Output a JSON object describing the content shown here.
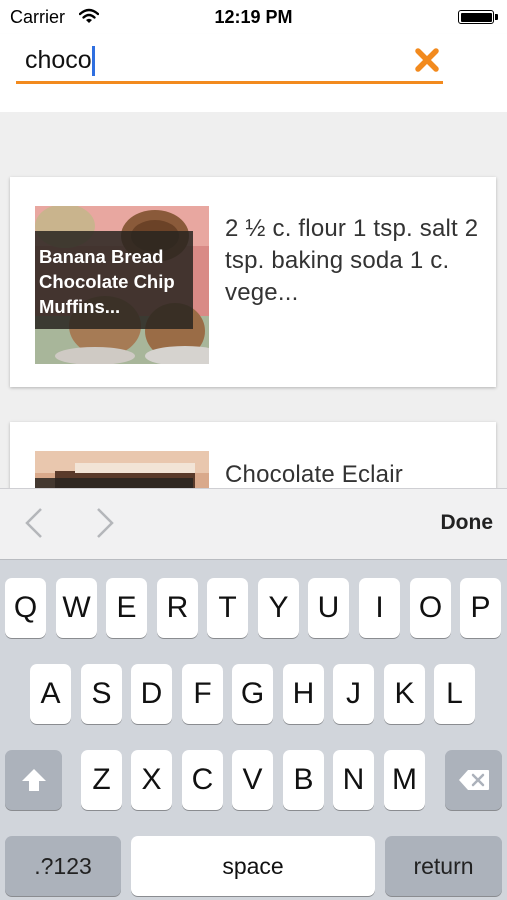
{
  "status_bar": {
    "carrier": "Carrier",
    "time": "12:19 PM"
  },
  "search": {
    "value": "choco"
  },
  "results": [
    {
      "title": "Banana Bread Chocolate Chip Muffins...",
      "description": "2 ½ c. flour   1 tsp. salt   2 tsp. baking soda   1 c. vege..."
    },
    {
      "title": "",
      "description": "Chocolate Eclair"
    }
  ],
  "accessory_bar": {
    "done_label": "Done"
  },
  "keyboard": {
    "row1": [
      "Q",
      "W",
      "E",
      "R",
      "T",
      "Y",
      "U",
      "I",
      "O",
      "P"
    ],
    "row2": [
      "A",
      "S",
      "D",
      "F",
      "G",
      "H",
      "J",
      "K",
      "L"
    ],
    "row3": [
      "Z",
      "X",
      "C",
      "V",
      "B",
      "N",
      "M"
    ],
    "numbers_label": ".?123",
    "space_label": "space",
    "return_label": "return"
  },
  "colors": {
    "accent": "#f28a1e",
    "caret": "#2f6fe0"
  }
}
